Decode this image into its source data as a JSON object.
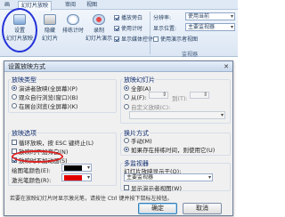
{
  "ribbon": {
    "tabs": [
      "画",
      "幻灯片放映",
      "审阅",
      "视图"
    ],
    "buttons": [
      {
        "label": "设置",
        "sub": "幻灯片放映"
      },
      {
        "label": "隐藏",
        "sub": "幻灯片"
      },
      {
        "label": "排练计时"
      },
      {
        "label": "录制",
        "sub": "幻灯片演示"
      }
    ],
    "checks": [
      {
        "label": "播放旁白",
        "checked": true
      },
      {
        "label": "使用计时",
        "checked": true
      },
      {
        "label": "显示媒体控件",
        "checked": true
      }
    ],
    "monitor_checks": [
      "分辨率:",
      "显示位置:",
      "使用演示者视图"
    ],
    "resolution_value": "使用当前",
    "display_value": "主要监视器",
    "group_label": "监视器"
  },
  "dialog": {
    "title": "设置放映方式",
    "close": "✕",
    "show_type": {
      "title": "放映类型",
      "options": [
        "演讲者放映(全屏幕)(P)",
        "观众自行浏览(窗口)(B)",
        "在展台浏览(全屏幕)(K)"
      ],
      "selected": 0
    },
    "show_slides": {
      "title": "放映幻灯片",
      "all": "全部(A)",
      "from": "从(F):",
      "to": "到(T):",
      "custom": "自定义放映(C):"
    },
    "show_options": {
      "title": "放映选项",
      "items": [
        "循环放映，按 ESC 键终止(L)",
        "放映时不加旁白(N)",
        "放映时不加动画(S)"
      ],
      "pen_color_label": "绘图笔颜色(E):",
      "laser_color_label": "激光笔颜色(R):",
      "pen_color": "#000000",
      "laser_color": "#e00000"
    },
    "advance": {
      "title": "换片方式",
      "options": [
        "手动(M)",
        "如果存在排练时间，则使用它(U)"
      ],
      "selected": 1
    },
    "monitors": {
      "title": "多监视器",
      "show_on_label": "幻灯片放映显示于(O):",
      "show_on_value": "主要监视器",
      "presenter_view": "显示演示者视图(W)"
    },
    "hint": "若要在放映幻灯片时显示激光笔，请按住 Ctrl 键并按下鼠标左按钮。",
    "ok": "确定",
    "cancel": "取消"
  },
  "colors": {
    "highlight_circle": "#2533d8",
    "annotation_ellipse": "#e02020",
    "ribbon_text": "#1e395b"
  }
}
